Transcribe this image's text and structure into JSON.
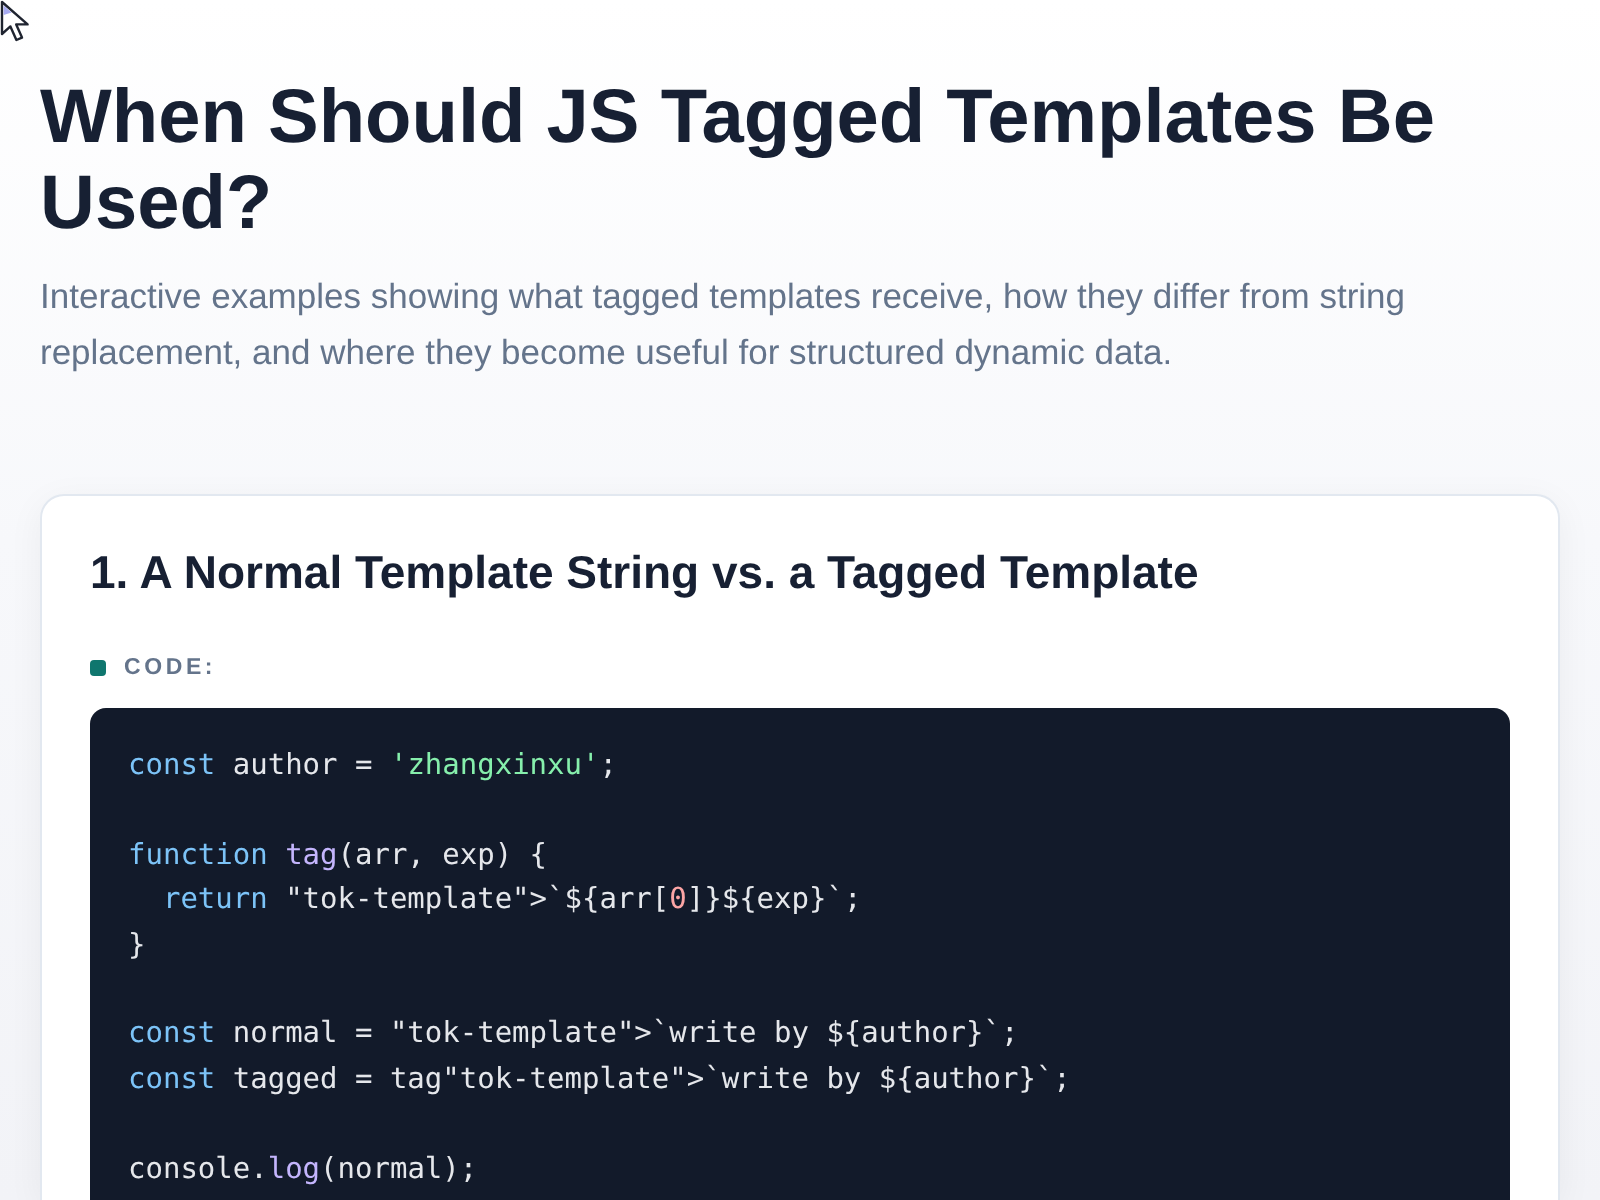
{
  "page": {
    "title": "When Should JS Tagged Templates Be Used?",
    "subtitle": "Interactive examples showing what tagged templates receive, how they differ from string replacement, and where they become useful for structured dynamic data."
  },
  "sections": [
    {
      "heading": "1. A Normal Template String vs. a Tagged Template",
      "code_label": "CODE:",
      "code": [
        [
          [
            {
              "text": "const",
              "kind": "keyword"
            },
            {
              "text": " author = ",
              "kind": "plain"
            },
            {
              "text": "'zhangxinxu'",
              "kind": "string"
            },
            {
              "text": ";",
              "kind": "plain"
            }
          ]
        ],
        [
          [
            {
              "text": "function",
              "kind": "keyword"
            },
            {
              "text": " tag",
              "kind": "function"
            },
            {
              "text": "(arr, exp) {",
              "kind": "plain"
            }
          ],
          [
            {
              "text": "  return",
              "kind": "keyword"
            },
            {
              "text": " \"tok-template\">`${arr[",
              "kind": "plain"
            },
            {
              "text": "0",
              "kind": "number"
            },
            {
              "text": "]}${exp}`;",
              "kind": "plain"
            }
          ],
          [
            {
              "text": "}",
              "kind": "plain"
            }
          ]
        ],
        [
          [
            {
              "text": "const",
              "kind": "keyword"
            },
            {
              "text": " normal = \"tok-template\">`write by ${author}`;",
              "kind": "plain"
            }
          ],
          [
            {
              "text": "const",
              "kind": "keyword"
            },
            {
              "text": " tagged = tag\"tok-template\">`write by ${author}`;",
              "kind": "plain"
            }
          ]
        ],
        [
          [
            {
              "text": "console.",
              "kind": "plain"
            },
            {
              "text": "log",
              "kind": "function"
            },
            {
              "text": "(normal);",
              "kind": "plain"
            }
          ]
        ]
      ]
    }
  ]
}
